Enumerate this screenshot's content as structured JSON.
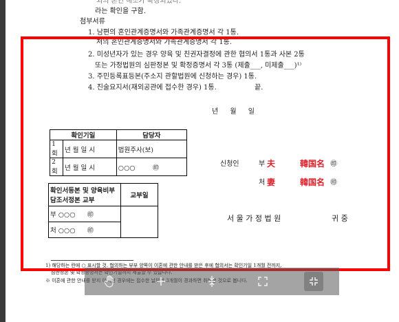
{
  "doc": {
    "line_top_1": "외의 혼인 해소가 확정되었다.",
    "line_top_2": "라는 확인을 구함.",
    "attachments_heading": "첨부서류",
    "item1_partial": "1. 남편의 혼인관계증명서와 가족관계증명서 각 1통.",
    "item1_cont": "처의 혼인관계증명서와 가족관계증명서 각 1통.",
    "item2": "2. 미성년자가 있는 경우 양육 및 친권자결정에 관한 협의서 1통과 사본 2통",
    "item2_cont": "또는 가정법원의 심판정본 및 확정증명서 각 3통 (제출___, 미제출___)¹⁾",
    "item3": "3. 주민등록표등본(주소지 관할법원에 신청하는 경우) 1통.",
    "item4": "4. 진술요지서(재외공관에 접수한 경우) 1통.",
    "item4_end": "끝.",
    "date_line": "년   월   일",
    "table1": {
      "h1": "확인기일",
      "h2": "담당자",
      "r1_label": "1회",
      "r1_date": "년  월  일  시",
      "r1_person": "법원주사(보)",
      "r2_label": "2회",
      "r2_date": "년  월  일  시",
      "r2_person": "○○○",
      "seal": "㊞"
    },
    "table2": {
      "h1": "확인서등본 및 양육비부담조서정본 교부",
      "h2": "교부일",
      "r1": "부  ○○○",
      "r2": "처  ○○○",
      "seal": "㊞"
    },
    "applicant_label": "신청인",
    "husband_prefix": "부",
    "husband_name": "夫",
    "husband_nation": "韓国名",
    "wife_prefix": "처",
    "wife_name": "妻",
    "wife_nation": "韓国名",
    "seal": "㊞",
    "court_name": "서 울 가 정 법 원",
    "court_suffix": "귀 중",
    "footnote1": "1) 해당하는 란에 ○ 표시할 것. 협의하는 부부 양쪽이 이혼에 관한 안내를 받은 후에 협의서는 확인기일 1개월 전까지,",
    "footnote1_cont": "심판정본 및 확정증명서는 확인기일까지 제출할 수 있습니다.",
    "footnote2": "※ 이혼에 관한 안내를 받지 아니한 경우에는 접수한 날부터 3개월이 경과하면 취하한 것으로 봅니다."
  },
  "toolbar": {
    "hand_icon": "hand-icon",
    "zoom_in_icon": "plus-icon",
    "fit_icon": "fit-page-icon",
    "fullscreen_icon": "fullscreen-icon",
    "exit_fullscreen_icon": "exit-fullscreen-icon"
  },
  "colors": {
    "highlight": "#ff0000",
    "name_red": "#e0202a"
  }
}
